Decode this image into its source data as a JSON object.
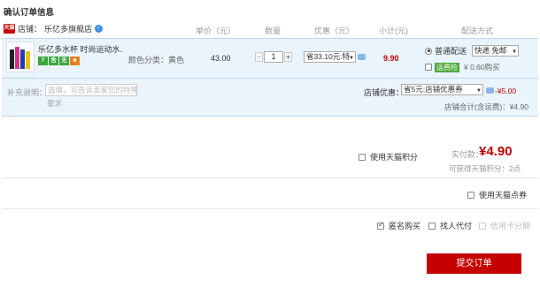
{
  "page": {
    "title": "确认订单信息"
  },
  "columns": {
    "price": "单价（元）",
    "qty": "数量",
    "discount": "优惠（元）",
    "subtotal": "小计(元)",
    "shipping": "配送方式"
  },
  "shop": {
    "badge": "天猫",
    "label": "店铺：",
    "name": "乐亿多旗舰店"
  },
  "item": {
    "title": "乐亿多水杯 时尚运动水...",
    "badges": [
      {
        "text": "7",
        "color": "#3aa53a"
      },
      {
        "text": "含",
        "color": "#3aa53a"
      },
      {
        "text": "无",
        "color": "#3aa53a"
      },
      {
        "text": "■",
        "color": "#e67e22"
      }
    ],
    "sku": "颜色分类：黄色",
    "price": "43.00",
    "quantity": "1",
    "promo": "省33.10元:特",
    "subtotal": "9.90"
  },
  "shipping": {
    "option": "普通配送",
    "select": "快递 免邮",
    "insurance_label": "运费险",
    "insurance_fee": "¥ 0.60购买"
  },
  "note": {
    "label": "补充说明：",
    "placeholder": "选填，可告诉卖家您的特殊",
    "more": "要求"
  },
  "shop_promo": {
    "label": "店铺优惠：",
    "select": "省5元:店铺优惠券",
    "discount": "-¥5.00",
    "total": "店铺合计(含运费)：¥4.90"
  },
  "payment": {
    "tmall_points": "使用天猫积分",
    "paid_label": "实付款：",
    "paid_value": "¥4.90",
    "earn": "可获得天猫积分：2点",
    "coupon": "使用天猫点券"
  },
  "options": {
    "anonymous": "匿名购买",
    "proxy": "找人代付",
    "credit": "信用卡分期"
  },
  "submit": "提交订单"
}
